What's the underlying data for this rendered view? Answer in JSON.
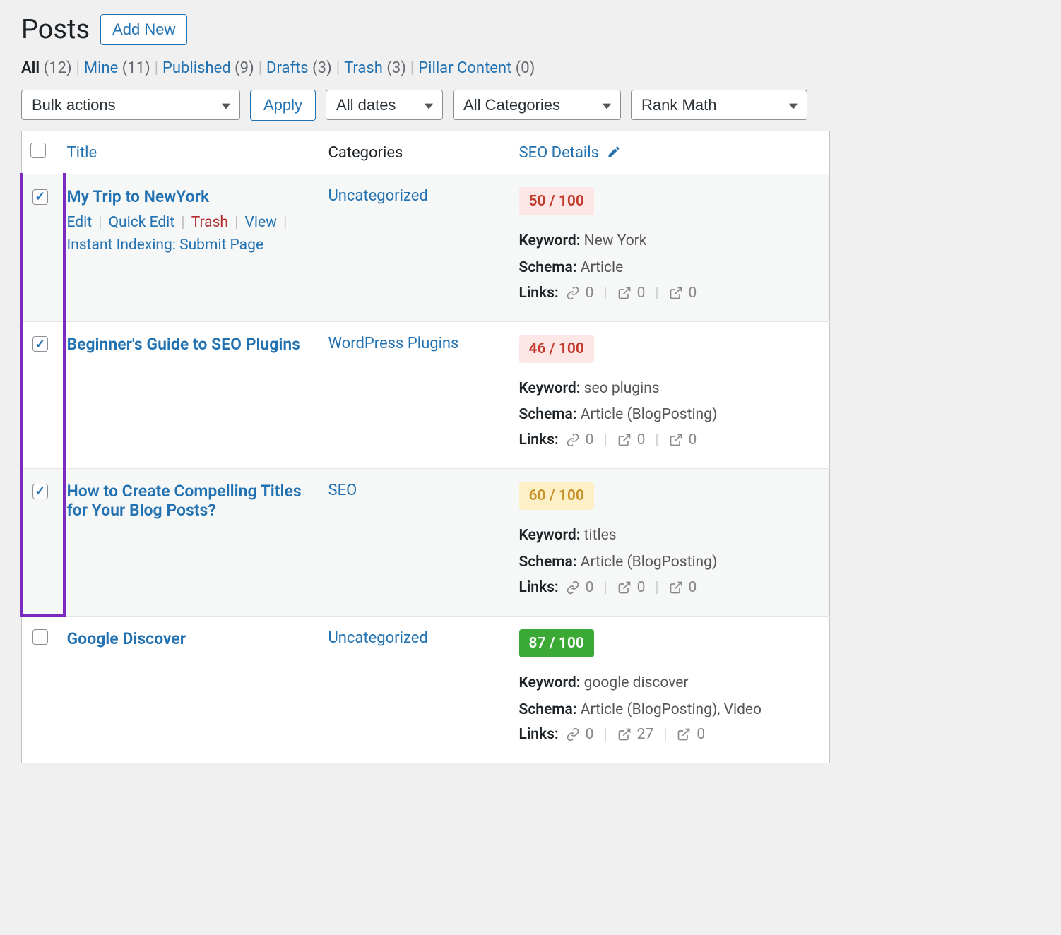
{
  "header": {
    "title": "Posts",
    "add_new": "Add New"
  },
  "filters": [
    {
      "label": "All",
      "count": "(12)",
      "active": true
    },
    {
      "label": "Mine",
      "count": "(11)"
    },
    {
      "label": "Published",
      "count": "(9)"
    },
    {
      "label": "Drafts",
      "count": "(3)"
    },
    {
      "label": "Trash",
      "count": "(3)"
    },
    {
      "label": "Pillar Content",
      "count": "(0)"
    }
  ],
  "toolbar": {
    "bulk": "Bulk actions",
    "apply": "Apply",
    "dates": "All dates",
    "cats": "All Categories",
    "rankmath": "Rank Math"
  },
  "columns": {
    "title": "Title",
    "categories": "Categories",
    "seo": "SEO Details"
  },
  "row_actions": {
    "edit": "Edit",
    "quick": "Quick Edit",
    "trash": "Trash",
    "view": "View",
    "instant": "Instant Indexing: Submit Page"
  },
  "labels": {
    "keyword": "Keyword:",
    "schema": "Schema:",
    "links": "Links:"
  },
  "posts": [
    {
      "checked": true,
      "title": "My Trip to NewYork",
      "show_actions": true,
      "category": "Uncategorized",
      "score": "50 / 100",
      "score_class": "red",
      "keyword": "New York",
      "schema": "Article",
      "links": {
        "internal": "0",
        "external": "0",
        "incoming": "0"
      }
    },
    {
      "checked": true,
      "title": "Beginner's Guide to SEO Plugins",
      "category": "WordPress Plugins",
      "score": "46 / 100",
      "score_class": "red",
      "keyword": "seo plugins",
      "schema": "Article (BlogPosting)",
      "links": {
        "internal": "0",
        "external": "0",
        "incoming": "0"
      }
    },
    {
      "checked": true,
      "title": "How to Create Compelling Titles for Your Blog Posts?",
      "category": "SEO",
      "score": "60 / 100",
      "score_class": "yellow",
      "keyword": "titles",
      "schema": "Article (BlogPosting)",
      "links": {
        "internal": "0",
        "external": "0",
        "incoming": "0"
      }
    },
    {
      "checked": false,
      "title": "Google Discover",
      "category": "Uncategorized",
      "score": "87 / 100",
      "score_class": "green",
      "keyword": "google discover",
      "schema": "Article (BlogPosting), Video",
      "links": {
        "internal": "0",
        "external": "27",
        "incoming": "0"
      }
    }
  ]
}
